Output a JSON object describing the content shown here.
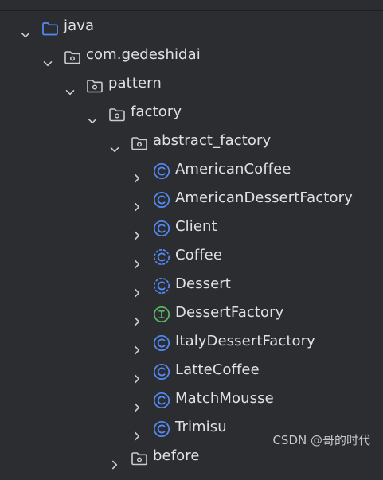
{
  "tree": {
    "nodes": [
      {
        "label": "java",
        "type": "source-folder",
        "expanded": true
      },
      {
        "label": "com.gedeshidai",
        "type": "package",
        "expanded": true
      },
      {
        "label": "pattern",
        "type": "package",
        "expanded": true
      },
      {
        "label": "factory",
        "type": "package",
        "expanded": true
      },
      {
        "label": "abstract_factory",
        "type": "package",
        "expanded": true
      },
      {
        "label": "AmericanCoffee",
        "type": "class",
        "expanded": false
      },
      {
        "label": "AmericanDessertFactory",
        "type": "class",
        "expanded": false
      },
      {
        "label": "Client",
        "type": "class",
        "expanded": false
      },
      {
        "label": "Coffee",
        "type": "abstract-class",
        "expanded": false
      },
      {
        "label": "Dessert",
        "type": "abstract-class",
        "expanded": false
      },
      {
        "label": "DessertFactory",
        "type": "interface",
        "expanded": false
      },
      {
        "label": "ItalyDessertFactory",
        "type": "class",
        "expanded": false
      },
      {
        "label": "LatteCoffee",
        "type": "class",
        "expanded": false
      },
      {
        "label": "MatchMousse",
        "type": "class",
        "expanded": false
      },
      {
        "label": "Trimisu",
        "type": "class",
        "expanded": false
      },
      {
        "label": "before",
        "type": "package",
        "expanded": false
      }
    ]
  },
  "watermark": "CSDN @哥的时代",
  "colors": {
    "background": "#2b2d30",
    "text": "#dfe1e5",
    "class_icon": "#548af7",
    "interface_icon": "#5fb865",
    "folder_icon": "#548af7"
  }
}
